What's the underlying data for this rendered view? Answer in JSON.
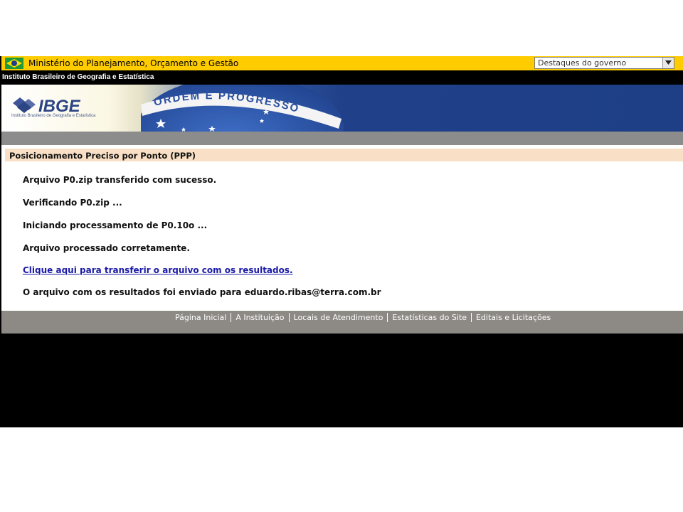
{
  "gov_bar": {
    "ministry": "Ministério do Planejamento, Orçamento e Gestão",
    "select_value": "Destaques do governo"
  },
  "institute_bar": {
    "name": "Instituto Brasileiro de Geografia e Estatística"
  },
  "banner": {
    "logo_text": "IBGE",
    "logo_subtitle": "Instituto Brasileiro de Geografia e Estatística",
    "motto": "ORDEM E PROGRESSO"
  },
  "content": {
    "title": "Posicionamento Preciso por Ponto (PPP)",
    "messages": [
      "Arquivo P0.zip transferido com sucesso.",
      "Verificando P0.zip ...",
      "Iniciando processamento de P0.10o ...",
      "Arquivo processado corretamente."
    ],
    "download_link": "Clique aqui para transferir o arquivo com os resultados.",
    "email_message": "O arquivo com os resultados foi enviado para eduardo.ribas@terra.com.br"
  },
  "footer": {
    "links": [
      "Página Inicial",
      "A Instituição",
      "Locais de Atendimento",
      "Estatísticas do Site",
      "Editais e Licitações"
    ]
  },
  "colors": {
    "gov_yellow": "#ffcc00",
    "title_bar": "#f8dfc5",
    "link_blue": "#1a1aa6",
    "footer_grey": "#8d8a86"
  }
}
